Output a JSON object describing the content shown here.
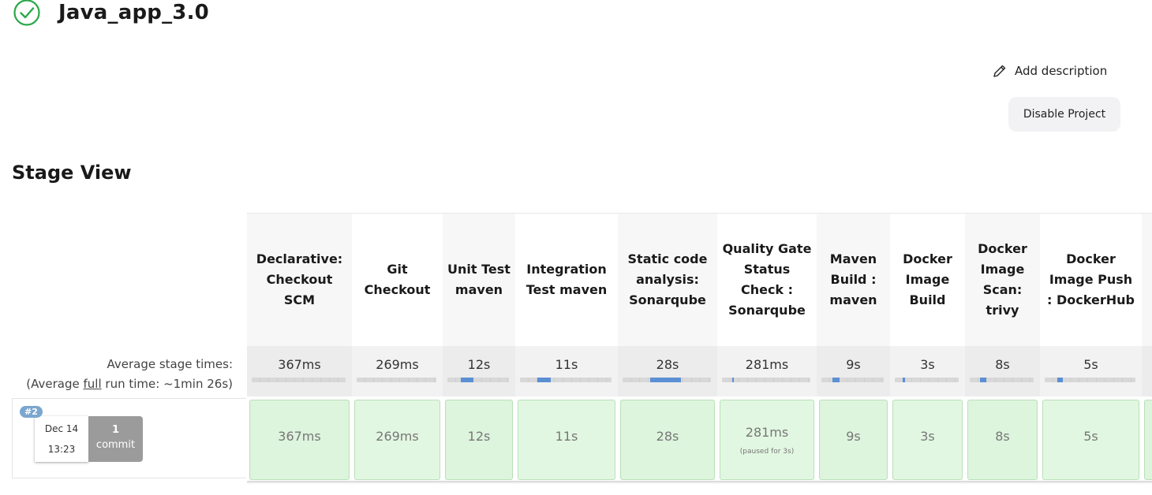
{
  "job": {
    "title": "Java_app_3.0",
    "status_icon": "success-check-icon",
    "status_color": "#2aa84a"
  },
  "actions": {
    "add_description": "Add description",
    "disable_project": "Disable Project"
  },
  "stage_view": {
    "title": "Stage View",
    "avg_label_line1": "Average stage times:",
    "avg_label_prefix": "(Average ",
    "avg_label_link": "full",
    "avg_label_suffix": " run time: ~1min 26s)",
    "stages": [
      {
        "name": "Declarative: Checkout SCM",
        "avg": "367ms",
        "run": "367ms",
        "note": "",
        "fill": 0
      },
      {
        "name": "Git Checkout",
        "avg": "269ms",
        "run": "269ms",
        "note": "",
        "fill": 0
      },
      {
        "name": "Unit Test maven",
        "avg": "12s",
        "run": "12s",
        "note": "",
        "fill": 0.2
      },
      {
        "name": "Integration Test maven",
        "avg": "11s",
        "run": "11s",
        "note": "",
        "fill": 0.15
      },
      {
        "name": "Static code analysis: Sonarqube",
        "avg": "28s",
        "run": "28s",
        "note": "",
        "fill": 0.35
      },
      {
        "name": "Quality Gate Status Check : Sonarqube",
        "avg": "281ms",
        "run": "281ms",
        "note": "(paused for 3s)",
        "fill": 0.02
      },
      {
        "name": "Maven Build : maven",
        "avg": "9s",
        "run": "9s",
        "note": "",
        "fill": 0.12
      },
      {
        "name": "Docker Image Build",
        "avg": "3s",
        "run": "3s",
        "note": "",
        "fill": 0.04
      },
      {
        "name": "Docker Image Scan: trivy",
        "avg": "8s",
        "run": "8s",
        "note": "",
        "fill": 0.1
      },
      {
        "name": "Docker Image Push : DockerHub",
        "avg": "5s",
        "run": "5s",
        "note": "",
        "fill": 0.06
      },
      {
        "name": "",
        "avg": "",
        "run": "",
        "note": "",
        "fill": 0
      }
    ]
  },
  "build": {
    "number": "#2",
    "date": "Dec 14",
    "time": "13:23",
    "commit_count": "1",
    "commit_label": "commit"
  }
}
